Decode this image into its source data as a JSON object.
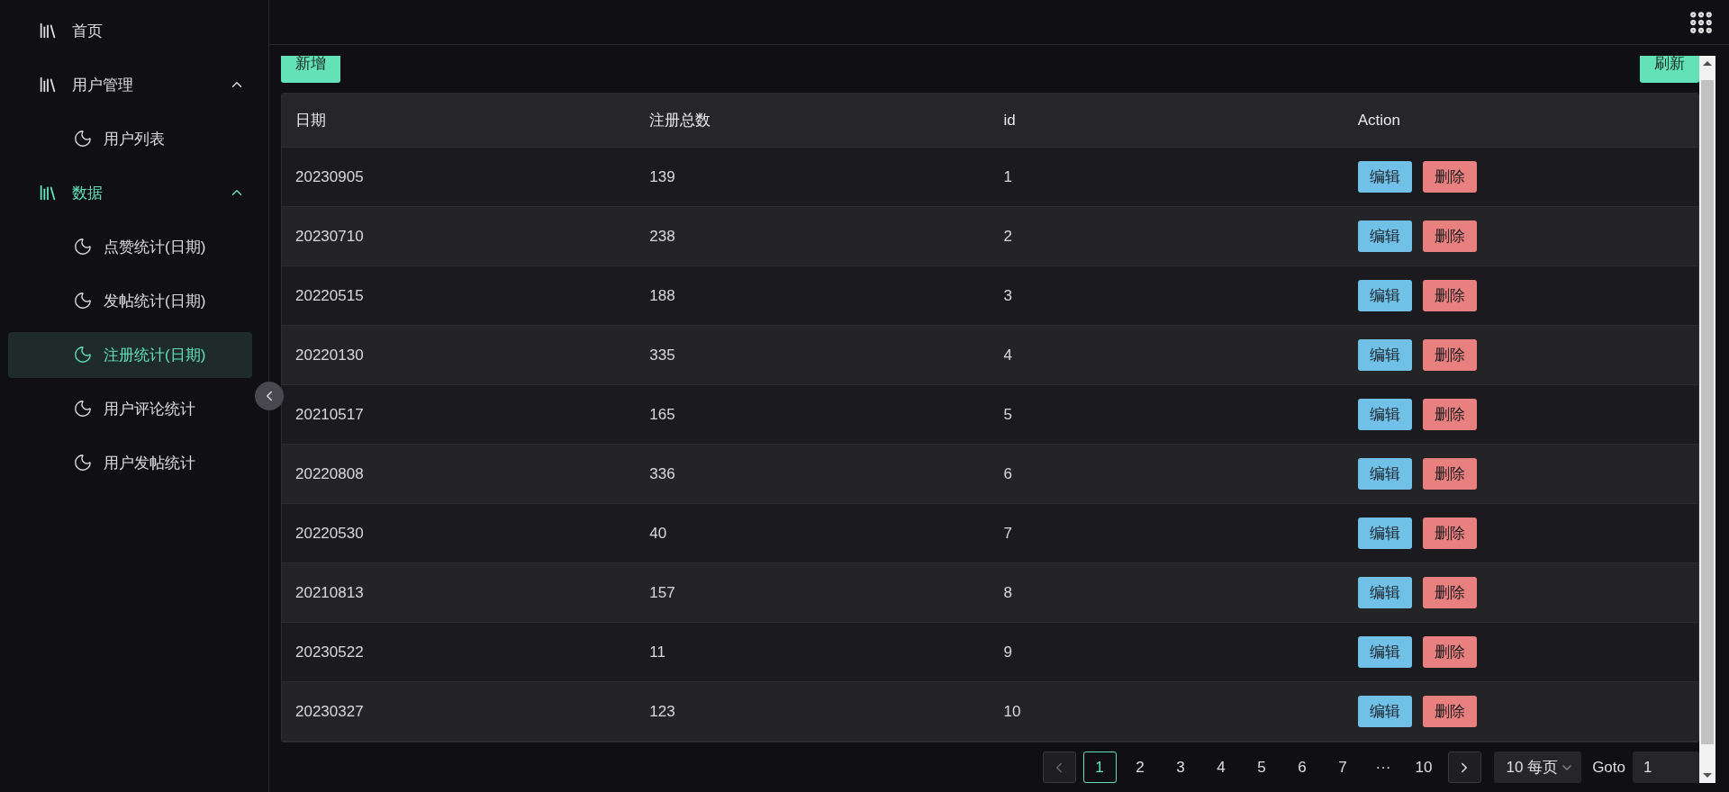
{
  "sidebar": {
    "items": [
      {
        "label": "首页"
      },
      {
        "label": "用户管理",
        "expanded": true,
        "children": [
          {
            "label": "用户列表",
            "selected": false
          }
        ]
      },
      {
        "label": "数据",
        "expanded": true,
        "children": [
          {
            "label": "点赞统计(日期)",
            "selected": false
          },
          {
            "label": "发帖统计(日期)",
            "selected": false
          },
          {
            "label": "注册统计(日期)",
            "selected": true
          },
          {
            "label": "用户评论统计",
            "selected": false
          },
          {
            "label": "用户发帖统计",
            "selected": false
          }
        ]
      }
    ]
  },
  "toolbar": {
    "add_button": "新增",
    "refresh_button": "刷新"
  },
  "table": {
    "columns": [
      "日期",
      "注册总数",
      "id",
      "Action"
    ],
    "rows": [
      {
        "date": "20230905",
        "total": "139",
        "id": "1",
        "edit": "编辑",
        "delete": "删除"
      },
      {
        "date": "20230710",
        "total": "238",
        "id": "2",
        "edit": "编辑",
        "delete": "删除"
      },
      {
        "date": "20220515",
        "total": "188",
        "id": "3",
        "edit": "编辑",
        "delete": "删除"
      },
      {
        "date": "20220130",
        "total": "335",
        "id": "4",
        "edit": "编辑",
        "delete": "删除"
      },
      {
        "date": "20210517",
        "total": "165",
        "id": "5",
        "edit": "编辑",
        "delete": "删除"
      },
      {
        "date": "20220808",
        "total": "336",
        "id": "6",
        "edit": "编辑",
        "delete": "删除"
      },
      {
        "date": "20220530",
        "total": "40",
        "id": "7",
        "edit": "编辑",
        "delete": "删除"
      },
      {
        "date": "20210813",
        "total": "157",
        "id": "8",
        "edit": "编辑",
        "delete": "删除"
      },
      {
        "date": "20230522",
        "total": "11",
        "id": "9",
        "edit": "编辑",
        "delete": "删除"
      },
      {
        "date": "20230327",
        "total": "123",
        "id": "10",
        "edit": "编辑",
        "delete": "删除"
      }
    ]
  },
  "pagination": {
    "pages": [
      {
        "label": "1",
        "selected": true
      },
      {
        "label": "2",
        "selected": false
      },
      {
        "label": "3",
        "selected": false
      },
      {
        "label": "4",
        "selected": false
      },
      {
        "label": "5",
        "selected": false
      },
      {
        "label": "6",
        "selected": false
      },
      {
        "label": "7",
        "selected": false
      },
      {
        "label": "···",
        "selected": false
      },
      {
        "label": "10",
        "selected": false
      }
    ],
    "page_size": "10 每页",
    "goto_label": "Goto",
    "goto_value": "1"
  }
}
